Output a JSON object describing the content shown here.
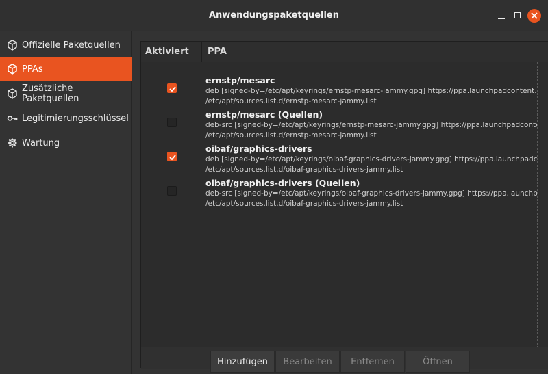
{
  "window": {
    "title": "Anwendungspaketquellen"
  },
  "sidebar": {
    "items": [
      {
        "label": "Offizielle Paketquellen",
        "icon": "package-icon"
      },
      {
        "label": "PPAs",
        "icon": "package-icon",
        "active": true
      },
      {
        "label": "Zusätzliche Paketquellen",
        "icon": "package-icon"
      },
      {
        "label": "Legitimierungsschlüssel",
        "icon": "key-icon"
      },
      {
        "label": "Wartung",
        "icon": "gear-icon"
      }
    ]
  },
  "table": {
    "columns": [
      "Aktiviert",
      "PPA"
    ],
    "rows": [
      {
        "enabled": true,
        "name": "ernstp/mesarc",
        "line1": "deb [signed-by=/etc/apt/keyrings/ernstp-mesarc-jammy.gpg] https://ppa.launchpadcontent.net/ernstp",
        "line2": "/etc/apt/sources.list.d/ernstp-mesarc-jammy.list"
      },
      {
        "enabled": false,
        "name": "ernstp/mesarc (Quellen)",
        "line1": "deb-src [signed-by=/etc/apt/keyrings/ernstp-mesarc-jammy.gpg] https://ppa.launchpadcontent.net/ernstp",
        "line2": "/etc/apt/sources.list.d/ernstp-mesarc-jammy.list"
      },
      {
        "enabled": true,
        "name": "oibaf/graphics-drivers",
        "line1": "deb [signed-by=/etc/apt/keyrings/oibaf-graphics-drivers-jammy.gpg] https://ppa.launchpadcontent.net/oibaf",
        "line2": "/etc/apt/sources.list.d/oibaf-graphics-drivers-jammy.list"
      },
      {
        "enabled": false,
        "name": "oibaf/graphics-drivers (Quellen)",
        "line1": "deb-src [signed-by=/etc/apt/keyrings/oibaf-graphics-drivers-jammy.gpg] https://ppa.launchpadcontent.net/oibaf",
        "line2": "/etc/apt/sources.list.d/oibaf-graphics-drivers-jammy.list"
      }
    ]
  },
  "toolbar": {
    "add": "Hinzufügen",
    "edit": "Bearbeiten",
    "remove": "Entfernen",
    "open": "Öffnen"
  },
  "colors": {
    "accent": "#e95420"
  }
}
